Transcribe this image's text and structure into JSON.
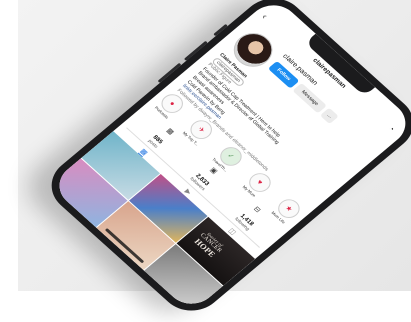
{
  "colors": {
    "follow_button": "#1c8ef2",
    "bezel": "#1b1b1d",
    "tab_active": "#2a7be4"
  },
  "status_bar": {
    "time": "",
    "signal": ""
  },
  "header": {
    "back_icon": "chevron-left-icon",
    "handle": "clairepasman",
    "notifications_icon": "bell-icon"
  },
  "profile": {
    "username": "claire.pasman",
    "follow_label": "Follow",
    "message_label": "Message",
    "more_label": "…",
    "bio": {
      "name": "Claire Pasman",
      "threads_handle": "clairepasman",
      "category": "Public Figure",
      "line1": "Founder of Cold Cap Treatment | Here to help",
      "line2": "Brand ambassador & Director of Global Training",
      "line3": "Breast awareness",
      "line4": "Cold Paravin by Beng",
      "link": "linktr.ee/claire.pasman",
      "followed_by": "Followed by dwaynr_Brands and eleanor_middletonds"
    }
  },
  "highlights": [
    {
      "label": "Podcasts",
      "icon": "mic-icon"
    },
    {
      "label": "My Trip T...",
      "icon": "plane-icon"
    },
    {
      "label": "TravelTh...",
      "icon": "check-icon"
    },
    {
      "label": "My Mum",
      "icon": "heart-icon"
    },
    {
      "label": "Mum Life",
      "icon": "star-icon"
    }
  ],
  "action_icons": [
    {
      "icon": "grid-icon",
      "label": ""
    },
    {
      "icon": "calendar-icon",
      "label": ""
    },
    {
      "icon": "bookmark-icon",
      "label": ""
    }
  ],
  "stats": [
    {
      "value": "885",
      "label": "posts"
    },
    {
      "value": "2,833",
      "label": "followers"
    },
    {
      "value": "1,418",
      "label": "following"
    }
  ],
  "tabs": [
    {
      "icon": "grid-icon"
    },
    {
      "icon": "video-icon"
    },
    {
      "icon": "tag-icon"
    }
  ],
  "grid_post_text": {
    "line_a": "Stories of",
    "line_b": "CANCER",
    "line_c": "HOPE"
  }
}
